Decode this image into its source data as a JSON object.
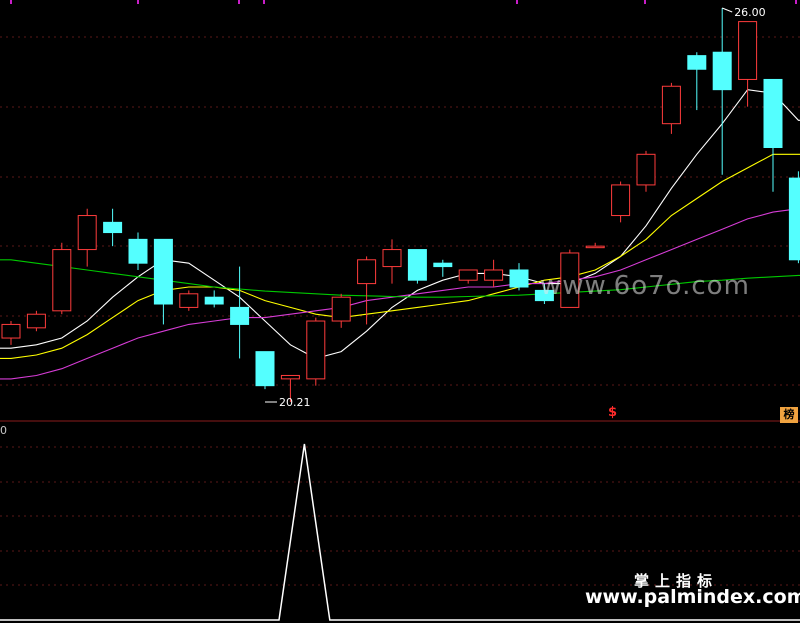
{
  "chart_data": {
    "type": "candlestick",
    "price_range": [
      19.2,
      26.2
    ],
    "candles": [
      {
        "o": 21.15,
        "h": 21.4,
        "l": 21.05,
        "c": 21.35
      },
      {
        "o": 21.3,
        "h": 21.55,
        "l": 21.25,
        "c": 21.5
      },
      {
        "o": 21.55,
        "h": 22.55,
        "l": 21.5,
        "c": 22.45
      },
      {
        "o": 22.45,
        "h": 23.05,
        "l": 22.2,
        "c": 22.95
      },
      {
        "o": 22.85,
        "h": 23.05,
        "l": 22.5,
        "c": 22.7
      },
      {
        "o": 22.6,
        "h": 22.7,
        "l": 22.15,
        "c": 22.25
      },
      {
        "o": 22.6,
        "h": 22.6,
        "l": 21.35,
        "c": 21.65
      },
      {
        "o": 21.6,
        "h": 21.85,
        "l": 21.55,
        "c": 21.8
      },
      {
        "o": 21.75,
        "h": 21.85,
        "l": 21.6,
        "c": 21.65
      },
      {
        "o": 21.6,
        "h": 22.2,
        "l": 20.85,
        "c": 21.35
      },
      {
        "o": 20.95,
        "h": 20.95,
        "l": 20.4,
        "c": 20.45
      },
      {
        "o": 20.55,
        "h": 20.6,
        "l": 20.21,
        "c": 20.6
      },
      {
        "o": 20.55,
        "h": 21.45,
        "l": 20.45,
        "c": 21.4
      },
      {
        "o": 21.4,
        "h": 21.8,
        "l": 21.3,
        "c": 21.75
      },
      {
        "o": 21.95,
        "h": 22.35,
        "l": 21.35,
        "c": 22.3
      },
      {
        "o": 22.2,
        "h": 22.6,
        "l": 21.95,
        "c": 22.45
      },
      {
        "o": 22.45,
        "h": 22.45,
        "l": 21.95,
        "c": 22.0
      },
      {
        "o": 22.25,
        "h": 22.3,
        "l": 22.05,
        "c": 22.2
      },
      {
        "o": 22.0,
        "h": 22.15,
        "l": 21.95,
        "c": 22.15
      },
      {
        "o": 22.0,
        "h": 22.3,
        "l": 21.9,
        "c": 22.15
      },
      {
        "o": 22.15,
        "h": 22.25,
        "l": 21.85,
        "c": 21.9
      },
      {
        "o": 21.85,
        "h": 21.95,
        "l": 21.65,
        "c": 21.7
      },
      {
        "o": 21.6,
        "h": 22.45,
        "l": 21.6,
        "c": 22.4
      },
      {
        "o": 22.5,
        "h": 22.55,
        "l": 22.5,
        "c": 22.5
      },
      {
        "o": 22.95,
        "h": 23.45,
        "l": 22.85,
        "c": 23.4
      },
      {
        "o": 23.4,
        "h": 23.9,
        "l": 23.3,
        "c": 23.85
      },
      {
        "o": 24.3,
        "h": 24.9,
        "l": 24.15,
        "c": 24.85
      },
      {
        "o": 25.3,
        "h": 25.35,
        "l": 24.5,
        "c": 25.1
      },
      {
        "o": 25.35,
        "h": 26.0,
        "l": 23.55,
        "c": 24.8
      },
      {
        "o": 24.95,
        "h": 25.75,
        "l": 24.55,
        "c": 25.8
      },
      {
        "o": 24.95,
        "h": 24.95,
        "l": 23.3,
        "c": 23.95
      },
      {
        "o": 23.5,
        "h": 23.6,
        "l": 22.25,
        "c": 22.3
      }
    ],
    "ma_lines": [
      {
        "color": "#ffffff",
        "values": [
          21.0,
          21.05,
          21.15,
          21.4,
          21.75,
          22.05,
          22.3,
          22.25,
          22.0,
          21.75,
          21.4,
          21.05,
          20.85,
          20.95,
          21.25,
          21.6,
          21.85,
          22.0,
          22.1,
          22.1,
          22.05,
          21.95,
          21.95,
          22.1,
          22.35,
          22.8,
          23.35,
          23.85,
          24.3,
          24.8,
          24.75,
          24.35
        ]
      },
      {
        "color": "#ffff00",
        "values": [
          20.85,
          20.9,
          21.0,
          21.2,
          21.45,
          21.7,
          21.85,
          21.9,
          21.9,
          21.85,
          21.7,
          21.6,
          21.5,
          21.45,
          21.5,
          21.55,
          21.6,
          21.65,
          21.7,
          21.8,
          21.9,
          22.0,
          22.05,
          22.15,
          22.35,
          22.6,
          22.95,
          23.2,
          23.45,
          23.65,
          23.85,
          23.85
        ]
      },
      {
        "color": "#d63cd6",
        "values": [
          20.55,
          20.6,
          20.7,
          20.85,
          21.0,
          21.15,
          21.25,
          21.35,
          21.4,
          21.45,
          21.45,
          21.5,
          21.55,
          21.6,
          21.7,
          21.75,
          21.8,
          21.85,
          21.9,
          21.9,
          21.95,
          21.95,
          22.0,
          22.05,
          22.15,
          22.3,
          22.45,
          22.6,
          22.75,
          22.9,
          23.0,
          23.05
        ]
      },
      {
        "color": "#00c800",
        "values": [
          22.3,
          22.25,
          22.2,
          22.15,
          22.1,
          22.05,
          22.0,
          21.95,
          21.9,
          21.87,
          21.84,
          21.82,
          21.8,
          21.78,
          21.77,
          21.76,
          21.75,
          21.75,
          21.76,
          21.77,
          21.78,
          21.8,
          21.82,
          21.84,
          21.86,
          21.9,
          21.94,
          21.98,
          22.0,
          22.03,
          22.05,
          22.07
        ]
      }
    ],
    "annotations": {
      "high_label": "26.00",
      "low_label": "20.21"
    },
    "indicator": {
      "color": "#ffffff",
      "values": [
        0,
        0,
        0,
        0,
        0,
        0,
        0,
        0,
        0,
        0,
        0,
        1,
        0,
        0,
        0,
        0,
        0,
        0,
        0,
        0,
        0,
        0,
        0,
        0,
        0,
        0,
        0,
        0,
        0,
        0,
        0,
        0
      ]
    },
    "colors": {
      "up": "#ff3c3c",
      "down": "#54ffff",
      "grid": "#5a1818",
      "divider": "#8a1c1c",
      "background": "#000000"
    }
  },
  "markers": {
    "signal": "$",
    "badge": "榜",
    "edge_zero": "0"
  },
  "watermarks": {
    "top": "www.6o7o.com",
    "bottom_cn": "掌上指标",
    "bottom": "www.palmindex.com"
  }
}
